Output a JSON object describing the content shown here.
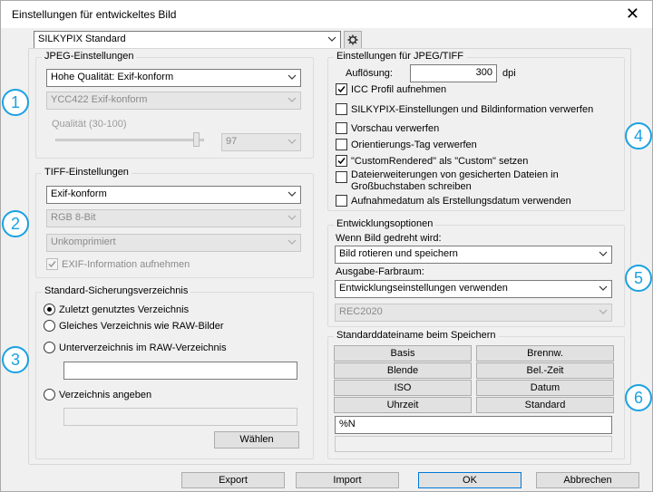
{
  "window": {
    "title": "Einstellungen für entwickeltes Bild"
  },
  "preset": {
    "value": "SILKYPIX Standard"
  },
  "jpeg": {
    "legend": "JPEG-Einstellungen",
    "quality_mode": "Hohe Qualität: Exif-konform",
    "color_format": "YCC422 Exif-konform",
    "quality_label": "Qualität (30-100)",
    "quality_value": "97",
    "quality_fraction": 0.97
  },
  "tiff": {
    "legend": "TIFF-Einstellungen",
    "format": "Exif-konform",
    "bit_depth": "RGB 8-Bit",
    "compression": "Unkomprimiert",
    "exif_label": "EXIF-Information aufnehmen"
  },
  "save_dir": {
    "legend": "Standard-Sicherungsverzeichnis",
    "option_last": "Zuletzt genutztes Verzeichnis",
    "option_same": "Gleiches Verzeichnis wie RAW-Bilder",
    "option_sub": "Unterverzeichnis im RAW-Verzeichnis",
    "subdir_value": "",
    "option_specify": "Verzeichnis angeben",
    "specify_value": "",
    "choose_button": "Wählen"
  },
  "jpeg_tiff": {
    "legend": "Einstellungen für JPEG/TIFF",
    "resolution_label": "Auflösung:",
    "resolution_value": "300",
    "resolution_unit": "dpi",
    "icc": "ICC Profil aufnehmen",
    "discard_silkypix": "SILKYPIX-Einstellungen und Bildinformation verwerfen",
    "discard_preview": "Vorschau verwerfen",
    "discard_orient": "Orientierungs-Tag verwerfen",
    "custom_rendered": "\"CustomRendered\" als \"Custom\" setzen",
    "uppercase_ext": "Dateierweiterungen von gesicherten Dateien in Großbuchstaben schreiben",
    "capture_date": "Aufnahmedatum als Erstellungsdatum verwenden"
  },
  "dev_options": {
    "legend": "Entwicklungsoptionen",
    "rotated_label": "Wenn Bild gedreht wird:",
    "rotated_value": "Bild rotieren und speichern",
    "colorspace_label": "Ausgabe-Farbraum:",
    "colorspace_value": "Entwicklungseinstellungen verwenden",
    "colorspace_profile": "REC2020"
  },
  "filename": {
    "legend": "Standarddateiname beim Speichern",
    "buttons": [
      "Basis",
      "Brennw.",
      "Blende",
      "Bel.-Zeit",
      "ISO",
      "Datum",
      "Uhrzeit",
      "Standard"
    ],
    "pattern_value": "%N",
    "preview_value": ""
  },
  "footer": {
    "export": "Export",
    "import": "Import",
    "ok": "OK",
    "cancel": "Abbrechen"
  },
  "markers": [
    "1",
    "2",
    "3",
    "4",
    "5",
    "6"
  ],
  "colors": {
    "accent": "#1ba1e2",
    "primary_border": "#0078d7"
  }
}
